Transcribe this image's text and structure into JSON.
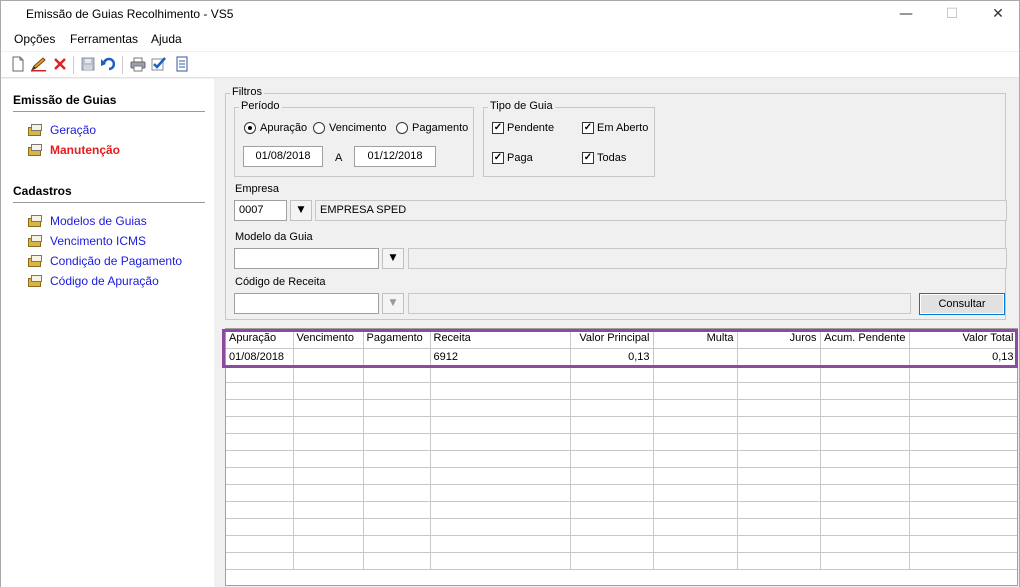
{
  "window": {
    "title": "Emissão de Guias Recolhimento - VS5",
    "min_glyph": "—",
    "max_glyph": "☐",
    "close_glyph": "✕"
  },
  "menu": [
    "Opções",
    "Ferramentas",
    "Ajuda"
  ],
  "toolbar": {
    "icons": [
      "new-icon",
      "edit-icon",
      "delete-icon",
      "save-icon",
      "undo-icon",
      "print-icon",
      "check-icon",
      "report-icon"
    ]
  },
  "sidebar": {
    "emissao_title": "Emissão de Guias",
    "emissao_items": [
      {
        "label": "Geração"
      },
      {
        "label": "Manutenção"
      }
    ],
    "cadastros_title": "Cadastros",
    "cadastros_items": [
      {
        "label": "Modelos de Guias"
      },
      {
        "label": "Vencimento ICMS"
      },
      {
        "label": "Condição de Pagamento"
      },
      {
        "label": "Código de Apuração"
      }
    ]
  },
  "filters": {
    "title": "Filtros",
    "periodo": {
      "title": "Período",
      "options": [
        "Apuração",
        "Vencimento",
        "Pagamento"
      ],
      "selected": "Apuração",
      "date_from": "01/08/2018",
      "separator": "A",
      "date_to": "01/12/2018"
    },
    "tipo_guia": {
      "title": "Tipo de Guia",
      "options": [
        {
          "label": "Pendente",
          "checked": true
        },
        {
          "label": "Em Aberto",
          "checked": true
        },
        {
          "label": "Paga",
          "checked": true
        },
        {
          "label": "Todas",
          "checked": true
        }
      ]
    },
    "empresa": {
      "label": "Empresa",
      "code": "0007",
      "name": "EMPRESA SPED"
    },
    "modelo": {
      "label": "Modelo da Guia",
      "value": "",
      "description": ""
    },
    "codigo_receita": {
      "label": "Código de Receita",
      "value": "",
      "description": ""
    },
    "consultar": "Consultar"
  },
  "grid": {
    "columns": [
      "Apuração",
      "Vencimento",
      "Pagamento",
      "Receita",
      "Valor Principal",
      "Multa",
      "Juros",
      "Acum. Pendente",
      "Valor Total"
    ],
    "rows": [
      [
        "01/08/2018",
        "",
        "",
        "6912",
        "0,13",
        "",
        "",
        "",
        "0,13"
      ]
    ],
    "empty_rows": 12
  },
  "colors": {
    "highlight": "#8e4aa0",
    "link": "#1a1adc",
    "active_link": "#e81c1c"
  }
}
